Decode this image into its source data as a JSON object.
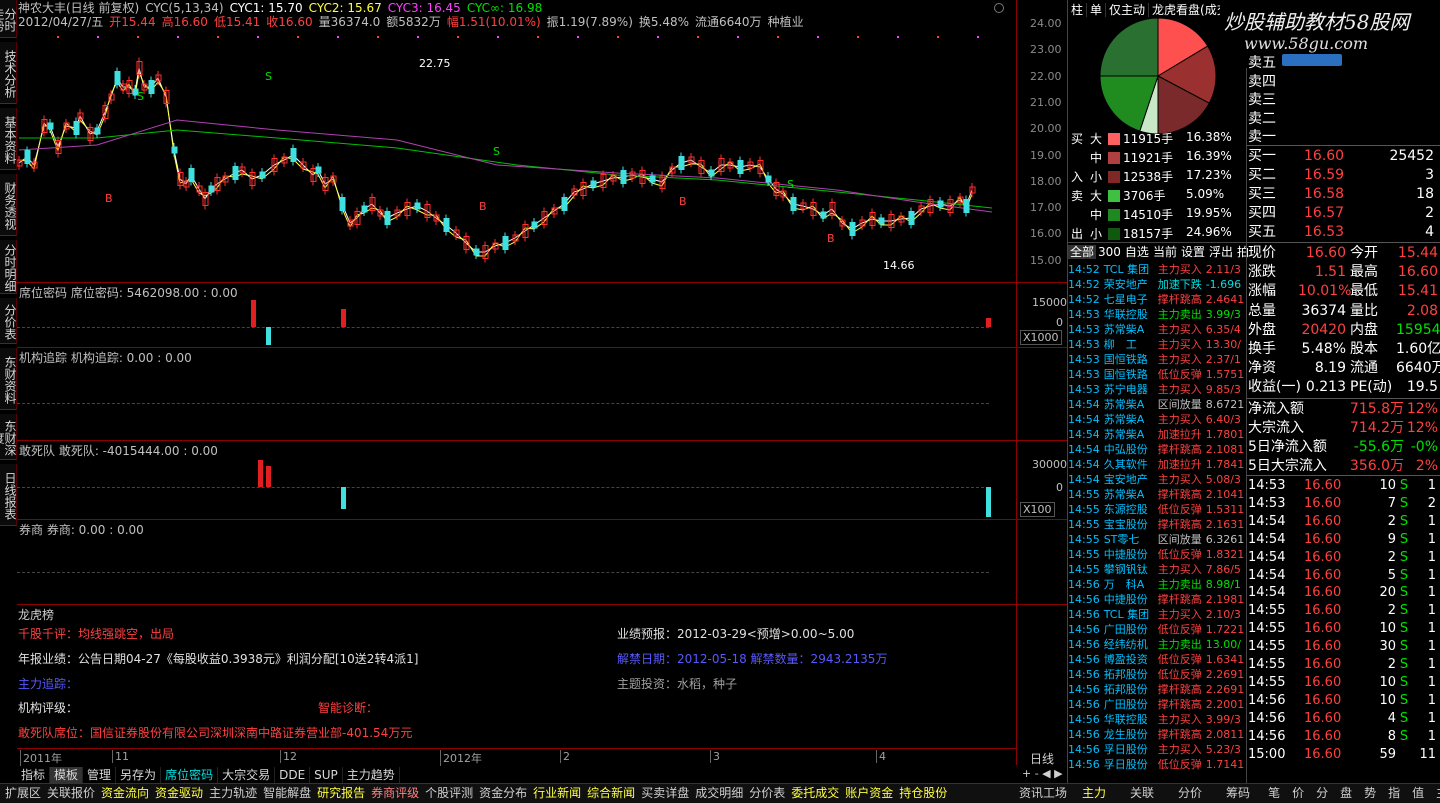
{
  "header": {
    "line1": [
      {
        "t": "神农大丰(日线 前复权)",
        "c": "#c0c0c0"
      },
      {
        "t": "CYC(5,13,34)",
        "c": "#c0c0c0"
      },
      {
        "t": "CYC1: 15.70",
        "c": "#ffffff"
      },
      {
        "t": "CYC2: 15.67",
        "c": "#ffff40"
      },
      {
        "t": "CYC3: 16.45",
        "c": "#ff40ff"
      },
      {
        "t": "CYC∞: 16.98",
        "c": "#00e000"
      }
    ],
    "line2": [
      {
        "t": "2012/04/27/五",
        "c": "#c0c0c0"
      },
      {
        "t": "开15.44",
        "c": "#ff4040"
      },
      {
        "t": "高16.60",
        "c": "#ff4040"
      },
      {
        "t": "低15.41",
        "c": "#ff4040"
      },
      {
        "t": "收16.60",
        "c": "#ff4040"
      },
      {
        "t": "量36374.0",
        "c": "#c0c0c0"
      },
      {
        "t": "额5832万",
        "c": "#c0c0c0"
      },
      {
        "t": "幅1.51(10.01%)",
        "c": "#ff4040"
      },
      {
        "t": "振1.19(7.89%)",
        "c": "#c0c0c0"
      },
      {
        "t": "换5.48%",
        "c": "#c0c0c0"
      },
      {
        "t": "流通6640万",
        "c": "#c0c0c0"
      },
      {
        "t": "种植业",
        "c": "#c0c0c0"
      }
    ]
  },
  "left_tabs": [
    "分时走势",
    "技术分析",
    "基本资料",
    "财务透视",
    "分时明细",
    "分价表",
    "东财资料",
    "东财深度",
    "日线报表"
  ],
  "y_axis": {
    "ticks": [
      "24.00",
      "23.00",
      "22.00",
      "21.00",
      "20.00",
      "19.00",
      "18.00",
      "17.00",
      "16.00",
      "15.00"
    ]
  },
  "chart_annotations": {
    "high": "22.75",
    "low": "14.66"
  },
  "indicator_panels": [
    {
      "title": "席位密码 席位密码: 5462098.00  : 0.00",
      "axis": "15000",
      "axis2": "0",
      "scale": "X1000"
    },
    {
      "title": "机构追踪 机构追踪: 0.00  : 0.00"
    },
    {
      "title": "敢死队 敢死队: -4015444.00  : 0.00",
      "axis": "30000",
      "axis2": "0",
      "scale": "X100"
    },
    {
      "title": "券商 券商: 0.00  : 0.00"
    }
  ],
  "dragon": {
    "title": "龙虎榜",
    "comment_label": "千股千评：均线强跳空，出局",
    "report": "年报业绩：公告日期04-27《每股收益0.3938元》利润分配[10送2转4派1]",
    "main_force": "主力追踪：",
    "inst_rating": "机构评级：",
    "smart_diag": "智能诊断：",
    "dare_seat": "敢死队席位：国信证券股份有限公司深圳深南中路证券营业部-401.54万元",
    "forecast": "业绩预报：2012-03-29<预增>0.00~5.00",
    "concept": "解禁日期：2012-05-18 解禁数量：2943.2135万",
    "theme": "主题投资：水稻，种子"
  },
  "time_axis": [
    "2011年",
    "11",
    "12",
    "2012年",
    "2",
    "3",
    "4"
  ],
  "period_label": "日线",
  "bottom_tabs": [
    "指标",
    "模板",
    "管理",
    "另存为",
    "席位密码",
    "大宗交易",
    "DDE",
    "SUP",
    "主力趋势"
  ],
  "footer_tabs": [
    "扩展区",
    "关联报价",
    "资金流向",
    "资金驱动",
    "主力轨迹",
    "智能解盘",
    "研究报告",
    "券商评级",
    "个股评测",
    "资金分布",
    "行业新闻",
    "综合新闻",
    "买卖详盘",
    "成交明细",
    "分价表",
    "委托成交",
    "账户资金",
    "持仓股份",
    "资讯工场"
  ],
  "right_footer_tabs": [
    "主力",
    "关联",
    "分价",
    "筹码",
    "笔",
    "价",
    "分",
    "盘",
    "势",
    "指",
    "值",
    "主",
    "其"
  ],
  "mid_panel": {
    "tabs": [
      "柱",
      "单",
      "仅主动",
      "龙虎看盘(成交"
    ],
    "pie_colors": [
      "#ff5050",
      "#a03030",
      "#802828",
      "#30a030",
      "#207020",
      "#104810"
    ],
    "flow": [
      {
        "side": "买",
        "size": "大",
        "vol": "11915手",
        "pct": "16.38%",
        "color": "#ff6060"
      },
      {
        "side": "",
        "size": "中",
        "vol": "11921手",
        "pct": "16.39%",
        "color": "#b04040"
      },
      {
        "side": "入",
        "size": "小",
        "vol": "12538手",
        "pct": "17.23%",
        "color": "#802828"
      },
      {
        "side": "卖",
        "size": "大",
        "vol": "3706手",
        "pct": "5.09%",
        "color": "#40c040"
      },
      {
        "side": "",
        "size": "中",
        "vol": "14510手",
        "pct": "19.95%",
        "color": "#208820"
      },
      {
        "side": "出",
        "size": "小",
        "vol": "18157手",
        "pct": "24.96%",
        "color": "#105810"
      }
    ],
    "list_tabs": [
      "全部",
      "300",
      "自选",
      "当前",
      "设置",
      "浮出",
      "拍"
    ],
    "list": [
      {
        "time": "14:52",
        "name": "TCL 集团",
        "act": "主力买入",
        "val": "2.11/3",
        "ac": "#ff4040"
      },
      {
        "time": "14:52",
        "name": "荣安地产",
        "act": "加速下跌",
        "val": "-1.696",
        "ac": "#00e0e0"
      },
      {
        "time": "14:52",
        "name": "七星电子",
        "act": "撑杆跳高",
        "val": "2.4641",
        "ac": "#ff4040"
      },
      {
        "time": "14:53",
        "name": "华联控股",
        "act": "主力卖出",
        "val": "3.99/3",
        "ac": "#00e000"
      },
      {
        "time": "14:53",
        "name": "苏常柴A",
        "act": "主力买入",
        "val": "6.35/4",
        "ac": "#ff4040"
      },
      {
        "time": "14:53",
        "name": "柳　工",
        "act": "主力买入",
        "val": "13.30/",
        "ac": "#ff4040"
      },
      {
        "time": "14:53",
        "name": "国恒铁路",
        "act": "主力买入",
        "val": "2.37/1",
        "ac": "#ff4040"
      },
      {
        "time": "14:53",
        "name": "国恒铁路",
        "act": "低位反弹",
        "val": "1.5751",
        "ac": "#ff4040"
      },
      {
        "time": "14:53",
        "name": "苏宁电器",
        "act": "主力买入",
        "val": "9.85/3",
        "ac": "#ff4040"
      },
      {
        "time": "14:54",
        "name": "苏常柴A",
        "act": "区间放量",
        "val": "8.6721",
        "ac": "#c0c0c0"
      },
      {
        "time": "14:54",
        "name": "苏常柴A",
        "act": "主力买入",
        "val": "6.40/3",
        "ac": "#ff4040"
      },
      {
        "time": "14:54",
        "name": "苏常柴A",
        "act": "加速拉升",
        "val": "1.7801",
        "ac": "#ff4040"
      },
      {
        "time": "14:54",
        "name": "中弘股份",
        "act": "撑杆跳高",
        "val": "2.1081",
        "ac": "#ff4040"
      },
      {
        "time": "14:54",
        "name": "久其软件",
        "act": "加速拉升",
        "val": "1.7841",
        "ac": "#ff4040"
      },
      {
        "time": "14:54",
        "name": "宝安地产",
        "act": "主力买入",
        "val": "5.08/3",
        "ac": "#ff4040"
      },
      {
        "time": "14:55",
        "name": "苏常柴A",
        "act": "撑杆跳高",
        "val": "2.1041",
        "ac": "#ff4040"
      },
      {
        "time": "14:55",
        "name": "东源控股",
        "act": "低位反弹",
        "val": "1.5311",
        "ac": "#ff4040"
      },
      {
        "time": "14:55",
        "name": "宝宝股份",
        "act": "撑杆跳高",
        "val": "2.1631",
        "ac": "#ff4040"
      },
      {
        "time": "14:55",
        "name": "ST零七",
        "act": "区间放量",
        "val": "6.3261",
        "ac": "#c0c0c0"
      },
      {
        "time": "14:55",
        "name": "中捷股份",
        "act": "低位反弹",
        "val": "1.8321",
        "ac": "#ff4040"
      },
      {
        "time": "14:55",
        "name": "攀钢钒钛",
        "act": "主力买入",
        "val": "7.86/5",
        "ac": "#ff4040"
      },
      {
        "time": "14:56",
        "name": "万　科A",
        "act": "主力卖出",
        "val": "8.98/1",
        "ac": "#00e000"
      },
      {
        "time": "14:56",
        "name": "中捷股份",
        "act": "撑杆跳高",
        "val": "2.1981",
        "ac": "#ff4040"
      },
      {
        "time": "14:56",
        "name": "TCL 集团",
        "act": "主力买入",
        "val": "2.10/3",
        "ac": "#ff4040"
      },
      {
        "time": "14:56",
        "name": "广田股份",
        "act": "低位反弹",
        "val": "1.7221",
        "ac": "#ff4040"
      },
      {
        "time": "14:56",
        "name": "经纬纺机",
        "act": "主力卖出",
        "val": "13.00/",
        "ac": "#00e000"
      },
      {
        "time": "14:56",
        "name": "博盈投资",
        "act": "低位反弹",
        "val": "1.6341",
        "ac": "#ff4040"
      },
      {
        "time": "14:56",
        "name": "拓邦股份",
        "act": "低位反弹",
        "val": "2.2691",
        "ac": "#ff4040"
      },
      {
        "time": "14:56",
        "name": "拓邦股份",
        "act": "撑杆跳高",
        "val": "2.2691",
        "ac": "#ff4040"
      },
      {
        "time": "14:56",
        "name": "广田股份",
        "act": "撑杆跳高",
        "val": "2.2001",
        "ac": "#ff4040"
      },
      {
        "time": "14:56",
        "name": "华联控股",
        "act": "主力买入",
        "val": "3.99/3",
        "ac": "#ff4040"
      },
      {
        "time": "14:56",
        "name": "龙生股份",
        "act": "撑杆跳高",
        "val": "2.0811",
        "ac": "#ff4040"
      },
      {
        "time": "14:56",
        "name": "孚日股份",
        "act": "主力买入",
        "val": "5.23/3",
        "ac": "#ff4040"
      },
      {
        "time": "14:56",
        "name": "孚日股份",
        "act": "低位反弹",
        "val": "1.7141",
        "ac": "#ff4040"
      }
    ]
  },
  "quote": {
    "watermark": "炒股辅助教材58股网",
    "watermark_url": "www.58gu.com",
    "sell_labels": [
      "卖五",
      "卖四",
      "卖三",
      "卖二",
      "卖一"
    ],
    "buy": [
      {
        "l": "买一",
        "p": "16.60",
        "v": "25452"
      },
      {
        "l": "买二",
        "p": "16.59",
        "v": "3"
      },
      {
        "l": "买三",
        "p": "16.58",
        "v": "18"
      },
      {
        "l": "买四",
        "p": "16.57",
        "v": "2"
      },
      {
        "l": "买五",
        "p": "16.53",
        "v": "4"
      }
    ],
    "stats": [
      {
        "a": "现价",
        "b": "16.60",
        "bc": "#ff4040",
        "c": "今开",
        "d": "15.44",
        "dc": "#ff4040"
      },
      {
        "a": "涨跌",
        "b": "1.51",
        "bc": "#ff4040",
        "c": "最高",
        "d": "16.60",
        "dc": "#ff4040"
      },
      {
        "a": "涨幅",
        "b": "10.01%",
        "bc": "#ff4040",
        "c": "最低",
        "d": "15.41",
        "dc": "#ff4040"
      },
      {
        "a": "总量",
        "b": "36374",
        "bc": "#ffffff",
        "c": "量比",
        "d": "2.08",
        "dc": "#ff4040"
      },
      {
        "a": "外盘",
        "b": "20420",
        "bc": "#ff4040",
        "c": "内盘",
        "d": "15954",
        "dc": "#00e000"
      },
      {
        "a": "换手",
        "b": "5.48%",
        "bc": "#ffffff",
        "c": "股本",
        "d": "1.60亿",
        "dc": "#ffffff"
      },
      {
        "a": "净资",
        "b": "8.19",
        "bc": "#ffffff",
        "c": "流通",
        "d": "6640万",
        "dc": "#ffffff"
      },
      {
        "a": "收益(一)",
        "b": "0.213",
        "bc": "#ffffff",
        "c": "PE(动)",
        "d": "19.5",
        "dc": "#ffffff"
      }
    ],
    "flows": [
      {
        "a": "净流入额",
        "b": "715.8万",
        "c": "12%",
        "bc": "#ff4040"
      },
      {
        "a": "大宗流入",
        "b": "714.2万",
        "c": "12%",
        "bc": "#ff4040"
      },
      {
        "a": "5日净流入额",
        "b": "-55.6万",
        "c": "-0%",
        "bc": "#00e000"
      },
      {
        "a": "5日大宗流入",
        "b": "356.0万",
        "c": "2%",
        "bc": "#ff4040"
      }
    ],
    "ticks": [
      {
        "t": "14:53",
        "p": "16.60",
        "v": "10",
        "s": "S",
        "n": "1"
      },
      {
        "t": "14:53",
        "p": "16.60",
        "v": "7",
        "s": "S",
        "n": "2"
      },
      {
        "t": "14:54",
        "p": "16.60",
        "v": "2",
        "s": "S",
        "n": "1"
      },
      {
        "t": "14:54",
        "p": "16.60",
        "v": "9",
        "s": "S",
        "n": "1"
      },
      {
        "t": "14:54",
        "p": "16.60",
        "v": "2",
        "s": "S",
        "n": "1"
      },
      {
        "t": "14:54",
        "p": "16.60",
        "v": "5",
        "s": "S",
        "n": "1"
      },
      {
        "t": "14:54",
        "p": "16.60",
        "v": "20",
        "s": "S",
        "n": "1"
      },
      {
        "t": "14:55",
        "p": "16.60",
        "v": "2",
        "s": "S",
        "n": "1"
      },
      {
        "t": "14:55",
        "p": "16.60",
        "v": "10",
        "s": "S",
        "n": "1"
      },
      {
        "t": "14:55",
        "p": "16.60",
        "v": "30",
        "s": "S",
        "n": "1"
      },
      {
        "t": "14:55",
        "p": "16.60",
        "v": "2",
        "s": "S",
        "n": "1"
      },
      {
        "t": "14:55",
        "p": "16.60",
        "v": "10",
        "s": "S",
        "n": "1"
      },
      {
        "t": "14:56",
        "p": "16.60",
        "v": "10",
        "s": "S",
        "n": "1"
      },
      {
        "t": "14:56",
        "p": "16.60",
        "v": "4",
        "s": "S",
        "n": "1"
      },
      {
        "t": "14:56",
        "p": "16.60",
        "v": "8",
        "s": "S",
        "n": "1"
      },
      {
        "t": "15:00",
        "p": "16.60",
        "v": "59",
        "s": "",
        "n": "11"
      }
    ]
  }
}
